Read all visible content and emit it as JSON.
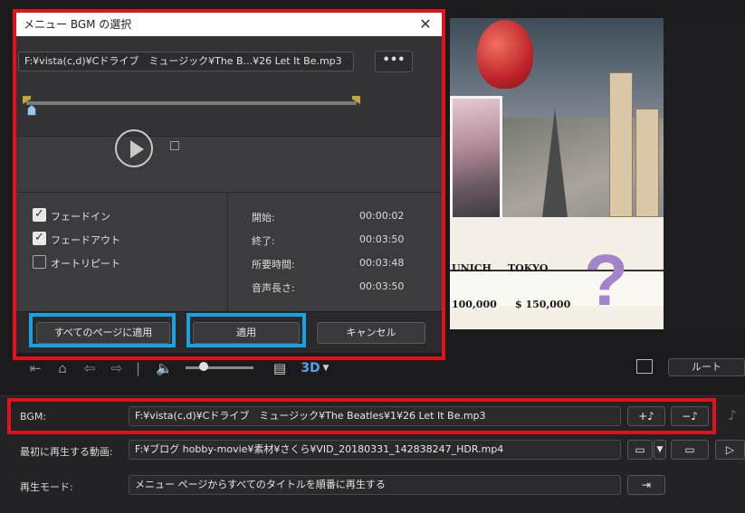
{
  "dialog": {
    "title": "メニュー BGM の選択",
    "path": "F:¥vista(c,d)¥Cドライブ　ミュージック¥The B...¥26 Let It Be.mp3",
    "browse_label": "•••",
    "options": {
      "fade_in": {
        "label": "フェードイン",
        "checked": true
      },
      "fade_out": {
        "label": "フェードアウト",
        "checked": true
      },
      "auto_repeat": {
        "label": "オートリピート",
        "checked": false
      }
    },
    "info": {
      "start_label": "開始:",
      "start_value": "00:00:02",
      "end_label": "終了:",
      "end_value": "00:03:50",
      "duration_label": "所要時間:",
      "duration_value": "00:03:48",
      "audio_length_label": "音声長さ:",
      "audio_length_value": "00:03:50"
    },
    "buttons": {
      "apply_all": "すべてのページに適用",
      "apply": "適用",
      "cancel": "キャンセル"
    }
  },
  "preview": {
    "board_labels": [
      "UNICH",
      "TOKYO",
      "100,000",
      "$ 150,000"
    ],
    "qmark": "?"
  },
  "playbar": {
    "route_label": "ルート",
    "three_d_label": "3D"
  },
  "settings": {
    "bgm_label": "BGM:",
    "bgm_value": "F:¥vista(c,d)¥Cドライブ　ミュージック¥The Beatles¥1¥26 Let It Be.mp3",
    "first_video_label": "最初に再生する動画:",
    "first_video_value": "F:¥ブログ hobby-movie¥素材¥さくら¥VID_20180331_142838247_HDR.mp4",
    "play_mode_label": "再生モード:",
    "play_mode_value": "メニュー ページからすべてのタイトルを順番に再生する",
    "add_music_label": "+♪",
    "remove_music_label": "−♪"
  },
  "colors": {
    "highlight_red": "#e0121b",
    "highlight_blue": "#1aa1de",
    "trim_marker": "#c8a23a"
  }
}
